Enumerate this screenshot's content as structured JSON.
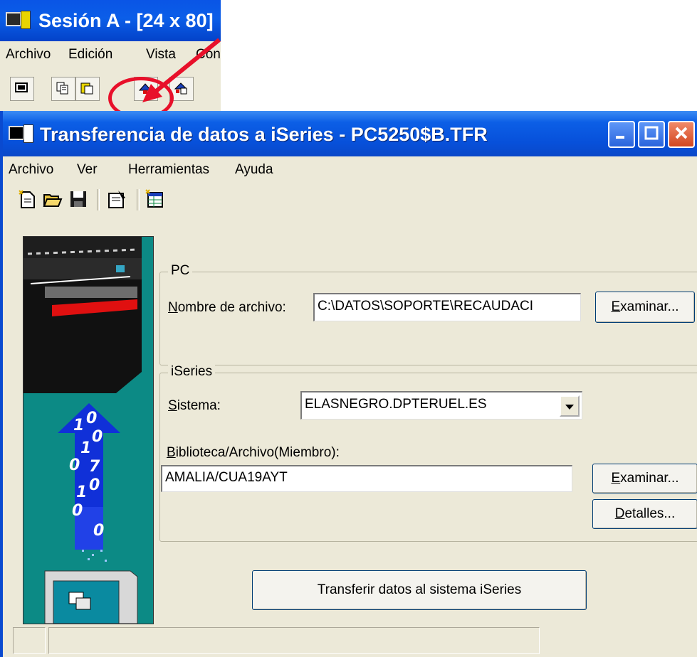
{
  "session_window": {
    "title": "Sesión A - [24 x 80]",
    "menu": [
      "Archivo",
      "Edición",
      "Vista",
      "Con"
    ]
  },
  "dialog": {
    "title": "Transferencia de datos a iSeries - PC5250$B.TFR",
    "menu": [
      "Archivo",
      "Ver",
      "Herramientas",
      "Ayuda"
    ],
    "toolbar_icons": [
      "new-icon",
      "open-folder-icon",
      "save-icon",
      "properties-icon",
      "table-icon"
    ],
    "pc_group": {
      "label": "PC",
      "file_label": "Nombre de archivo:",
      "file_value": "C:\\DATOS\\SOPORTE\\RECAUDACI",
      "browse": "Examinar..."
    },
    "iseries_group": {
      "label": "iSeries",
      "system_label": "Sistema:",
      "system_value": "ELASNEGRO.DPTERUEL.ES",
      "library_label": "Biblioteca/Archivo(Miembro):",
      "library_value": "AMALIA/CUA19AYT",
      "browse": "Examinar...",
      "details": "Detalles..."
    },
    "transfer_button": "Transferir datos al sistema iSeries",
    "illustration_binary": [
      "0",
      "1",
      "0",
      "1",
      "0",
      "7",
      "0",
      "1",
      "0",
      "0"
    ]
  },
  "colors": {
    "title_blue": "#0a55e6",
    "window_face": "#ece9d8",
    "illustration_teal": "#0c8a85",
    "highlight_red": "#e8102a"
  }
}
